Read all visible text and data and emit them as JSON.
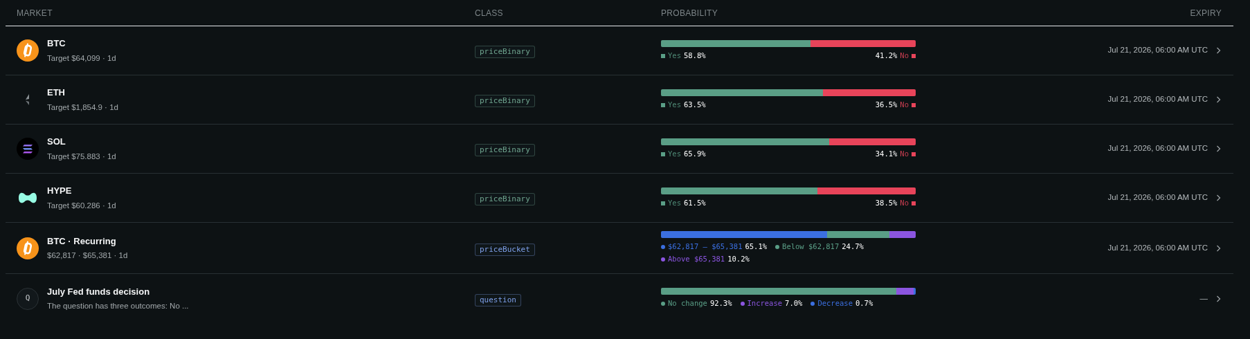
{
  "columns": [
    "MARKET",
    "CLASS",
    "PROBABILITY",
    "EXPIRY"
  ],
  "rows": [
    {
      "icon": {
        "kind": "btc"
      },
      "name": "BTC",
      "subtitle": "Target $64,099 · 1d",
      "class": {
        "label": "priceBinary",
        "color": "#6fa58f"
      },
      "probability": {
        "kind": "binary",
        "outcomes": [
          {
            "label": "Yes",
            "value": "58.8%",
            "color": "#5a9e86"
          },
          {
            "label": "No",
            "value": "41.2%",
            "color": "#e8445a"
          }
        ]
      },
      "expiry": "Jul 21, 2026, 06:00 AM UTC"
    },
    {
      "icon": {
        "kind": "eth"
      },
      "name": "ETH",
      "subtitle": "Target $1,854.9 · 1d",
      "class": {
        "label": "priceBinary",
        "color": "#6fa58f"
      },
      "probability": {
        "kind": "binary",
        "outcomes": [
          {
            "label": "Yes",
            "value": "63.5%",
            "color": "#5a9e86"
          },
          {
            "label": "No",
            "value": "36.5%",
            "color": "#e8445a"
          }
        ]
      },
      "expiry": "Jul 21, 2026, 06:00 AM UTC"
    },
    {
      "icon": {
        "kind": "sol"
      },
      "name": "SOL",
      "subtitle": "Target $75.883 · 1d",
      "class": {
        "label": "priceBinary",
        "color": "#6fa58f"
      },
      "probability": {
        "kind": "binary",
        "outcomes": [
          {
            "label": "Yes",
            "value": "65.9%",
            "color": "#5a9e86"
          },
          {
            "label": "No",
            "value": "34.1%",
            "color": "#e8445a"
          }
        ]
      },
      "expiry": "Jul 21, 2026, 06:00 AM UTC"
    },
    {
      "icon": {
        "kind": "hype"
      },
      "name": "HYPE",
      "subtitle": "Target $60.286 · 1d",
      "class": {
        "label": "priceBinary",
        "color": "#6fa58f"
      },
      "probability": {
        "kind": "binary",
        "outcomes": [
          {
            "label": "Yes",
            "value": "61.5%",
            "color": "#5a9e86"
          },
          {
            "label": "No",
            "value": "38.5%",
            "color": "#e8445a"
          }
        ]
      },
      "expiry": "Jul 21, 2026, 06:00 AM UTC"
    },
    {
      "icon": {
        "kind": "btc"
      },
      "name": "BTC · Recurring",
      "subtitle": "$62,817 · $65,381 · 1d",
      "class": {
        "label": "priceBucket",
        "color": "#7ea0ea"
      },
      "probability": {
        "kind": "outcomes",
        "outcomes": [
          {
            "label": "$62,817 – $65,381",
            "value": "65.1%",
            "color": "#3b6fe0"
          },
          {
            "label": "Below $62,817",
            "value": "24.7%",
            "color": "#5a9e86"
          },
          {
            "label": "Above $65,381",
            "value": "10.2%",
            "color": "#8b55e0"
          }
        ]
      },
      "expiry": "Jul 21, 2026, 06:00 AM UTC"
    },
    {
      "icon": {
        "kind": "letter",
        "text": "Q"
      },
      "name": "July Fed funds decision",
      "subtitle": "The question has three outcomes: No ...",
      "class": {
        "label": "question",
        "color": "#7ea0ea"
      },
      "probability": {
        "kind": "outcomes",
        "outcomes": [
          {
            "label": "No change",
            "value": "92.3%",
            "color": "#5a9e86"
          },
          {
            "label": "Increase",
            "value": "7.0%",
            "color": "#8b55e0"
          },
          {
            "label": "Decrease",
            "value": "0.7%",
            "color": "#3b6fe0"
          }
        ]
      },
      "expiry": "—"
    }
  ]
}
